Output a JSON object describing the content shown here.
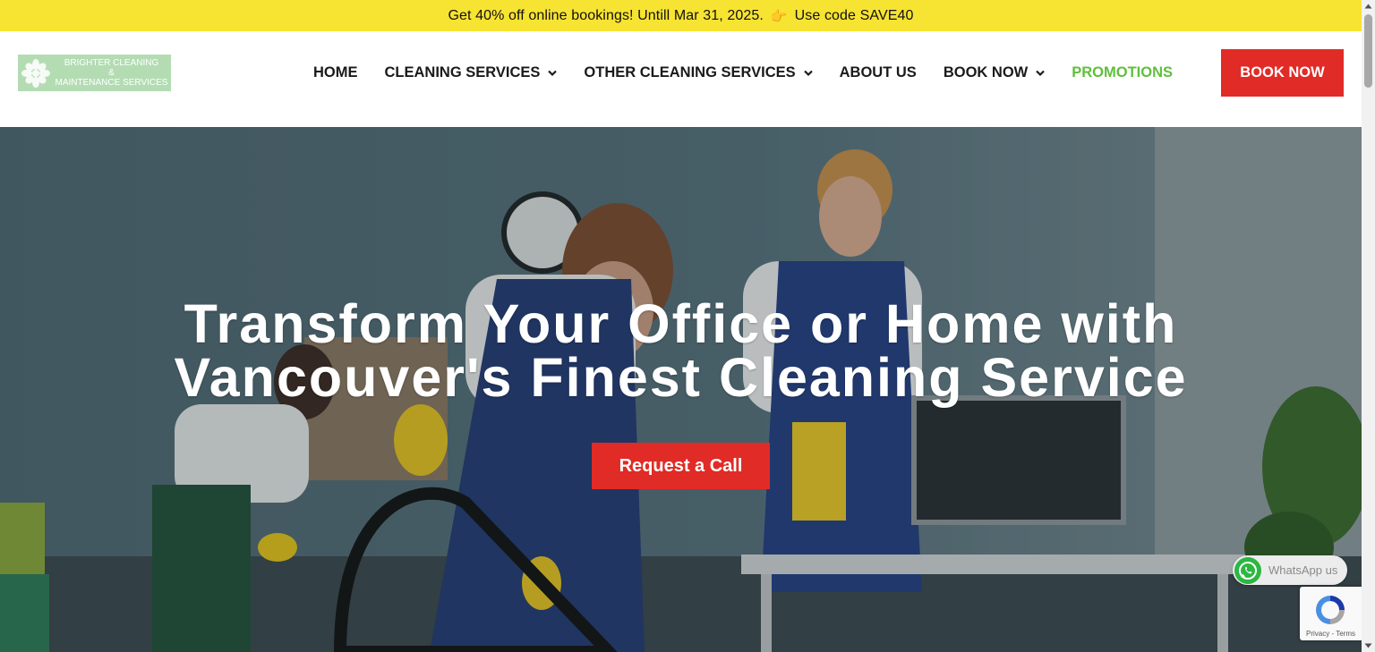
{
  "promo": {
    "text_before": "Get 40% off online bookings! Untill Mar 31, 2025.",
    "pointer_glyph": "👉",
    "text_after": "Use code SAVE40"
  },
  "logo": {
    "line1": "BRIGHTER CLEANING",
    "line2": "&",
    "line3": "MAINTENANCE SERVICES"
  },
  "nav": {
    "items": [
      {
        "label": "HOME",
        "dropdown": false
      },
      {
        "label": "CLEANING SERVICES",
        "dropdown": true
      },
      {
        "label": "OTHER CLEANING SERVICES",
        "dropdown": true
      },
      {
        "label": "ABOUT US",
        "dropdown": false
      },
      {
        "label": "BOOK NOW",
        "dropdown": true
      },
      {
        "label": "PROMOTIONS",
        "dropdown": false
      }
    ]
  },
  "header": {
    "book_button": "BOOK NOW"
  },
  "hero": {
    "title_line1": "Transform Your Office or Home with",
    "title_line2": "Vancouver's Finest Cleaning Service",
    "cta": "Request a Call"
  },
  "whatsapp": {
    "label": "WhatsApp us"
  },
  "recaptcha": {
    "links": "Privacy - Terms"
  },
  "colors": {
    "promo_bar": "#f7e332",
    "accent_red": "#e12b26",
    "promo_green": "#5fbf3c",
    "logo_bg": "#b3dcb3"
  }
}
